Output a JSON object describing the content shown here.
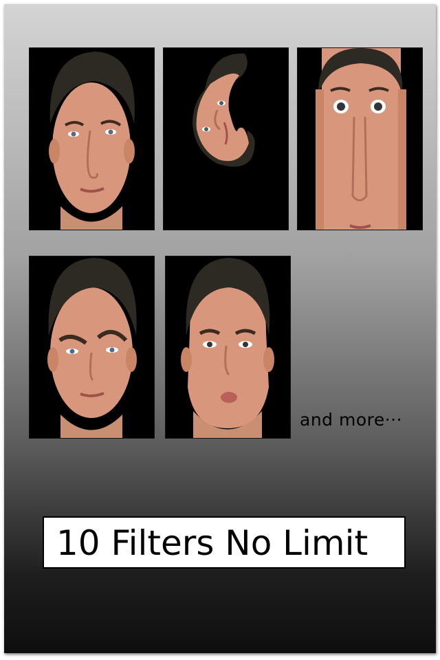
{
  "filters": [
    {
      "name": "face-filter-photo-original"
    },
    {
      "name": "face-filter-photo-swirl"
    },
    {
      "name": "face-filter-photo-stretch"
    },
    {
      "name": "face-filter-photo-raised-brow"
    },
    {
      "name": "face-filter-photo-chubby"
    }
  ],
  "more_label": "and more···",
  "banner": {
    "text": "10 Filters No Limit"
  },
  "colors": {
    "skin": "#d79a7e",
    "hair": "#2c2a22",
    "background": "#000000"
  }
}
